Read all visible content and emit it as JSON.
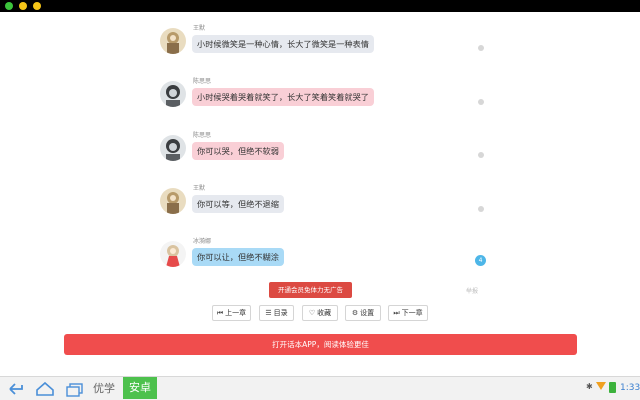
{
  "messages": [
    {
      "name": "王默",
      "text": "小时候微笑是一种心情，长大了微笑是一种表情",
      "style": "gray"
    },
    {
      "name": "陈思思",
      "text": "小时候哭着哭着就笑了，长大了笑着笑着就哭了",
      "style": "pink"
    },
    {
      "name": "陈思思",
      "text": "你可以哭，但绝不软弱",
      "style": "pink"
    },
    {
      "name": "王默",
      "text": "你可以等，但绝不退缩",
      "style": "gray"
    },
    {
      "name": "冰漪娜",
      "text": "你可以让，但绝不糊涂",
      "style": "blue"
    }
  ],
  "badge": "4",
  "vip_button": "开通会员免体力无广告",
  "report": "举报",
  "nav": {
    "prev": "上一章",
    "toc": "目录",
    "favorite": "收藏",
    "settings": "设置",
    "next": "下一章"
  },
  "open_app": "打开话本APP，阅读体验更佳",
  "taskbar": {
    "brand_a": "优学",
    "brand_b": "安卓",
    "time": "1:33"
  },
  "colors": {
    "accent_red": "#f04d4d",
    "vip_red": "#dc4a42",
    "bubble_gray": "#e6e9ef",
    "bubble_pink": "#f9cfd6",
    "bubble_blue": "#a9daf6",
    "taskbar_green": "#4dc14d"
  }
}
